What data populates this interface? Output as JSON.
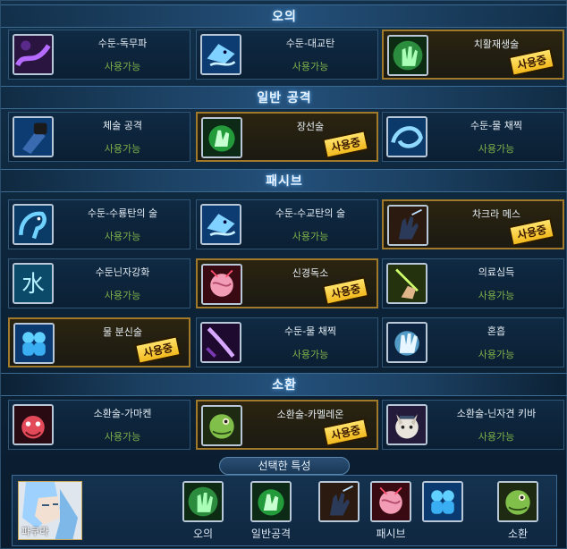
{
  "sections": {
    "ougi": "오의",
    "normal": "일반 공격",
    "passive": "패시브",
    "summon": "소환"
  },
  "cards": [
    {
      "name": "수둔-독무파",
      "status": "사용가능",
      "active": false,
      "icon": "purple-wave-icon"
    },
    {
      "name": "수둔-대교탄",
      "status": "사용가능",
      "active": false,
      "icon": "shark-icon"
    },
    {
      "name": "치활재생술",
      "status": "",
      "active": true,
      "icon": "healing-hand-icon"
    },
    {
      "name": "체술 공격",
      "status": "사용가능",
      "active": false,
      "icon": "fist-icon"
    },
    {
      "name": "장선술",
      "status": "",
      "active": true,
      "icon": "green-palm-icon"
    },
    {
      "name": "수둔-물 채찍",
      "status": "사용가능",
      "active": false,
      "icon": "water-whip-icon"
    },
    {
      "name": "수둔-수룡탄의 술",
      "status": "사용가능",
      "active": false,
      "icon": "water-dragon-icon"
    },
    {
      "name": "수둔-수교탄의 술",
      "status": "사용가능",
      "active": false,
      "icon": "shark-icon"
    },
    {
      "name": "차크라 메스",
      "status": "",
      "active": true,
      "icon": "chakra-glove-icon"
    },
    {
      "name": "수둔닌자강화",
      "status": "사용가능",
      "active": false,
      "icon": "water-kanji-icon"
    },
    {
      "name": "신경독소",
      "status": "",
      "active": true,
      "icon": "brain-icon"
    },
    {
      "name": "의료심득",
      "status": "사용가능",
      "active": false,
      "icon": "needle-hand-icon"
    },
    {
      "name": "물 분신술",
      "status": "",
      "active": true,
      "icon": "water-clone-icon"
    },
    {
      "name": "수둔-물 채찍",
      "status": "사용가능",
      "active": false,
      "icon": "purple-blade-icon"
    },
    {
      "name": "혼흡",
      "status": "사용가능",
      "active": false,
      "icon": "glowing-hand-icon"
    },
    {
      "name": "소환술-가마켄",
      "status": "사용가능",
      "active": false,
      "icon": "red-toad-icon"
    },
    {
      "name": "소환술-카멜레온",
      "status": "",
      "active": true,
      "icon": "chameleon-icon"
    },
    {
      "name": "소환술-닌자견 키바",
      "status": "사용가능",
      "active": false,
      "icon": "ninja-dog-icon"
    }
  ],
  "in_use_label": "사용중",
  "bottom": {
    "title": "선택한 특성",
    "character_name": "파쿠라",
    "labels": [
      "오의",
      "일반공격",
      "패시브",
      "소환"
    ]
  },
  "colors": {
    "available_text": "#7fb24a",
    "active_border": "#a07a2a",
    "badge": "#f2b91d"
  }
}
